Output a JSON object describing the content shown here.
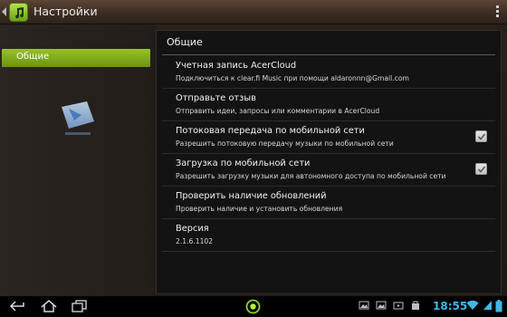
{
  "actionbar": {
    "title": "Настройки",
    "app_icon": "music-note-icon",
    "menu_icon": "overflow-menu-icon"
  },
  "nav": {
    "items": [
      {
        "label": "Общие",
        "selected": true
      }
    ]
  },
  "main": {
    "header": "Общие",
    "rows": [
      {
        "title": "Учетная запись AcerCloud",
        "subtitle": "Подключиться к clear.fi Music при помощи aldaronnn@Gmail.com"
      },
      {
        "title": "Отправьте отзыв",
        "subtitle": "Отправить идеи, запросы или комментарии в AcerCloud"
      },
      {
        "title": "Потоковая передача по мобильной сети",
        "subtitle": "Разрешить потоковую передачу музыки по мобильной сети",
        "checked": true
      },
      {
        "title": "Загрузка по мобильной сети",
        "subtitle": "Разрешить загрузку музыки для автономного доступа по мобильной сети",
        "checked": true
      },
      {
        "title": "Проверить наличие обновлений",
        "subtitle": "Проверить наличие и установить обновления"
      },
      {
        "title": "Версия",
        "subtitle": "2.1.6.1102"
      }
    ]
  },
  "sysbar": {
    "clock": "18:55",
    "accent": "#3fb8e8"
  },
  "colors": {
    "accent_green": "#8bb61f",
    "clock_blue": "#3fb8e8"
  }
}
